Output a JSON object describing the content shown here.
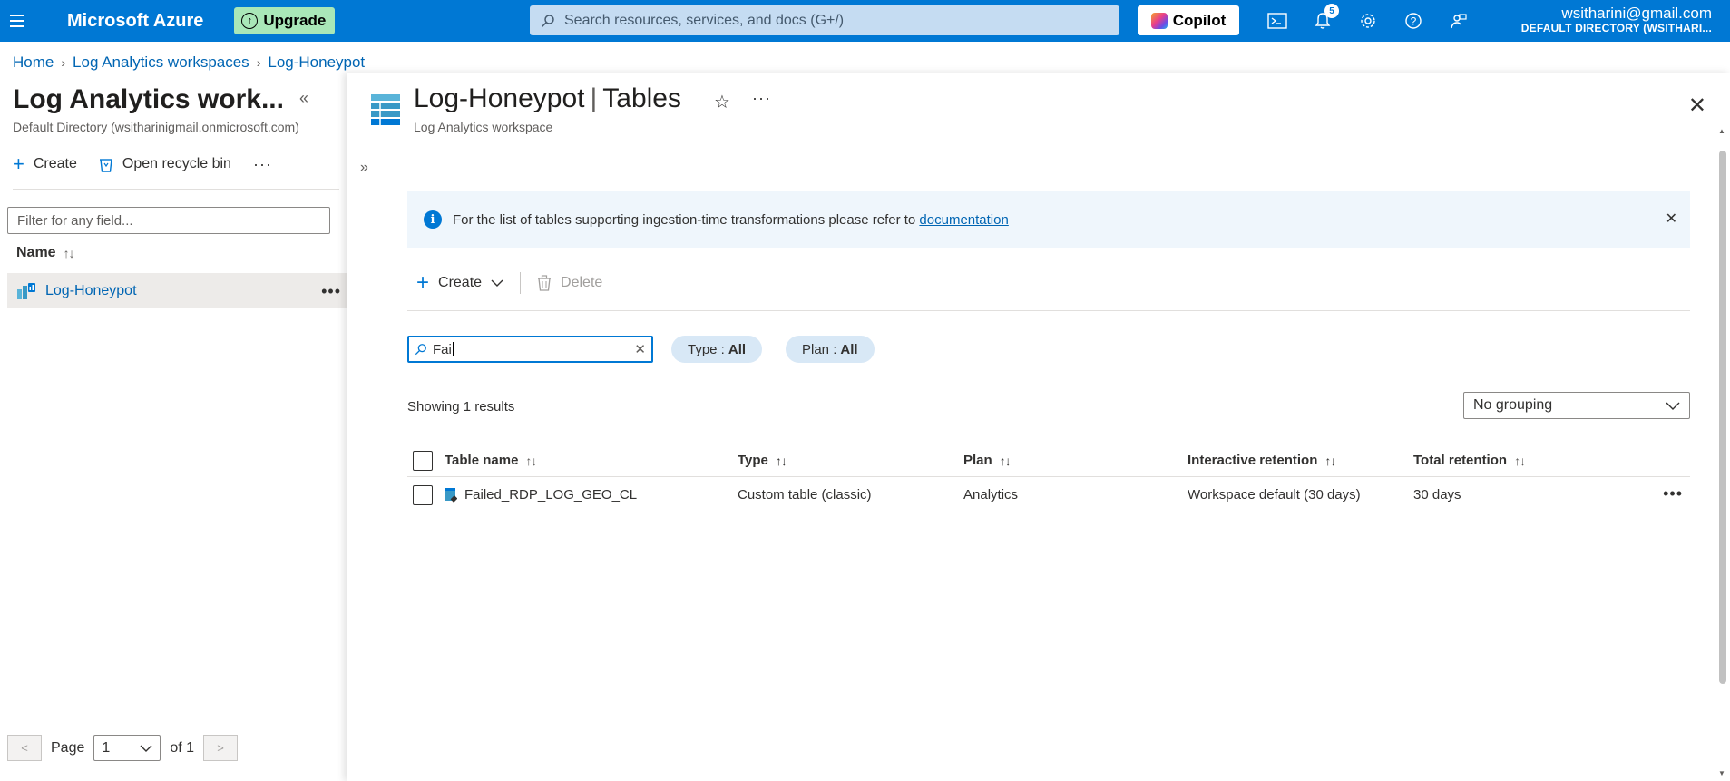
{
  "topbar": {
    "brand": "Microsoft Azure",
    "upgrade_label": "Upgrade",
    "search_placeholder": "Search resources, services, and docs (G+/)",
    "copilot_label": "Copilot",
    "notification_count": "5",
    "account_email": "wsitharini@gmail.com",
    "account_directory": "DEFAULT DIRECTORY (WSITHARI..."
  },
  "breadcrumb": {
    "items": [
      "Home",
      "Log Analytics workspaces",
      "Log-Honeypot"
    ]
  },
  "left_pane": {
    "title": "Log Analytics work...",
    "subtitle": "Default Directory (wsitharinigmail.onmicrosoft.com)",
    "create_label": "Create",
    "recycle_label": "Open recycle bin",
    "filter_placeholder": "Filter for any field...",
    "name_header": "Name",
    "items": [
      {
        "label": "Log-Honeypot"
      }
    ],
    "pager": {
      "page_label": "Page",
      "current": "1",
      "of_label": "of 1",
      "prev": "<",
      "next": ">"
    }
  },
  "blade": {
    "title_resource": "Log-Honeypot",
    "title_section": "Tables",
    "subtitle": "Log Analytics workspace",
    "info_text": "For the list of tables supporting ingestion-time transformations please refer to",
    "info_link": "documentation",
    "toolbar": {
      "create_label": "Create",
      "delete_label": "Delete"
    },
    "search_value": "Fai",
    "filters": [
      {
        "label": "Type :",
        "value": "All"
      },
      {
        "label": "Plan :",
        "value": "All"
      }
    ],
    "showing_text": "Showing 1 results",
    "grouping_value": "No grouping",
    "table": {
      "columns": [
        "Table name",
        "Type",
        "Plan",
        "Interactive retention",
        "Total retention"
      ],
      "rows": [
        {
          "name": "Failed_RDP_LOG_GEO_CL",
          "type": "Custom table (classic)",
          "plan": "Analytics",
          "interactive": "Workspace default (30 days)",
          "total": "30 days"
        }
      ]
    }
  },
  "colors": {
    "azure_blue": "#0078d4",
    "upgrade_green": "#a9e7b8",
    "info_bg": "#eff6fc",
    "pill_bg": "#d8e8f6"
  }
}
